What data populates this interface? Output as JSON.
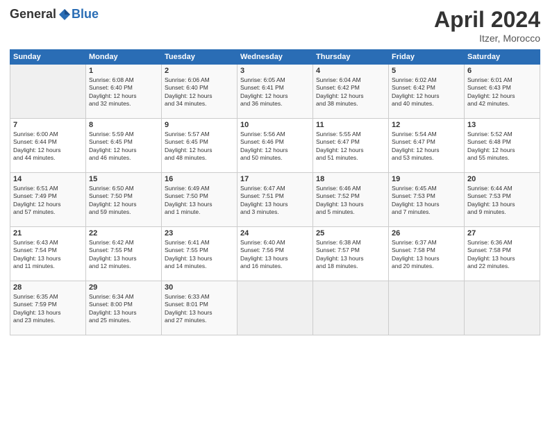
{
  "logo": {
    "general": "General",
    "blue": "Blue"
  },
  "title": "April 2024",
  "location": "Itzer, Morocco",
  "days_header": [
    "Sunday",
    "Monday",
    "Tuesday",
    "Wednesday",
    "Thursday",
    "Friday",
    "Saturday"
  ],
  "weeks": [
    [
      {
        "day": "",
        "info": ""
      },
      {
        "day": "1",
        "info": "Sunrise: 6:08 AM\nSunset: 6:40 PM\nDaylight: 12 hours\nand 32 minutes."
      },
      {
        "day": "2",
        "info": "Sunrise: 6:06 AM\nSunset: 6:40 PM\nDaylight: 12 hours\nand 34 minutes."
      },
      {
        "day": "3",
        "info": "Sunrise: 6:05 AM\nSunset: 6:41 PM\nDaylight: 12 hours\nand 36 minutes."
      },
      {
        "day": "4",
        "info": "Sunrise: 6:04 AM\nSunset: 6:42 PM\nDaylight: 12 hours\nand 38 minutes."
      },
      {
        "day": "5",
        "info": "Sunrise: 6:02 AM\nSunset: 6:42 PM\nDaylight: 12 hours\nand 40 minutes."
      },
      {
        "day": "6",
        "info": "Sunrise: 6:01 AM\nSunset: 6:43 PM\nDaylight: 12 hours\nand 42 minutes."
      }
    ],
    [
      {
        "day": "7",
        "info": "Sunrise: 6:00 AM\nSunset: 6:44 PM\nDaylight: 12 hours\nand 44 minutes."
      },
      {
        "day": "8",
        "info": "Sunrise: 5:59 AM\nSunset: 6:45 PM\nDaylight: 12 hours\nand 46 minutes."
      },
      {
        "day": "9",
        "info": "Sunrise: 5:57 AM\nSunset: 6:45 PM\nDaylight: 12 hours\nand 48 minutes."
      },
      {
        "day": "10",
        "info": "Sunrise: 5:56 AM\nSunset: 6:46 PM\nDaylight: 12 hours\nand 50 minutes."
      },
      {
        "day": "11",
        "info": "Sunrise: 5:55 AM\nSunset: 6:47 PM\nDaylight: 12 hours\nand 51 minutes."
      },
      {
        "day": "12",
        "info": "Sunrise: 5:54 AM\nSunset: 6:47 PM\nDaylight: 12 hours\nand 53 minutes."
      },
      {
        "day": "13",
        "info": "Sunrise: 5:52 AM\nSunset: 6:48 PM\nDaylight: 12 hours\nand 55 minutes."
      }
    ],
    [
      {
        "day": "14",
        "info": "Sunrise: 6:51 AM\nSunset: 7:49 PM\nDaylight: 12 hours\nand 57 minutes."
      },
      {
        "day": "15",
        "info": "Sunrise: 6:50 AM\nSunset: 7:50 PM\nDaylight: 12 hours\nand 59 minutes."
      },
      {
        "day": "16",
        "info": "Sunrise: 6:49 AM\nSunset: 7:50 PM\nDaylight: 13 hours\nand 1 minute."
      },
      {
        "day": "17",
        "info": "Sunrise: 6:47 AM\nSunset: 7:51 PM\nDaylight: 13 hours\nand 3 minutes."
      },
      {
        "day": "18",
        "info": "Sunrise: 6:46 AM\nSunset: 7:52 PM\nDaylight: 13 hours\nand 5 minutes."
      },
      {
        "day": "19",
        "info": "Sunrise: 6:45 AM\nSunset: 7:53 PM\nDaylight: 13 hours\nand 7 minutes."
      },
      {
        "day": "20",
        "info": "Sunrise: 6:44 AM\nSunset: 7:53 PM\nDaylight: 13 hours\nand 9 minutes."
      }
    ],
    [
      {
        "day": "21",
        "info": "Sunrise: 6:43 AM\nSunset: 7:54 PM\nDaylight: 13 hours\nand 11 minutes."
      },
      {
        "day": "22",
        "info": "Sunrise: 6:42 AM\nSunset: 7:55 PM\nDaylight: 13 hours\nand 12 minutes."
      },
      {
        "day": "23",
        "info": "Sunrise: 6:41 AM\nSunset: 7:55 PM\nDaylight: 13 hours\nand 14 minutes."
      },
      {
        "day": "24",
        "info": "Sunrise: 6:40 AM\nSunset: 7:56 PM\nDaylight: 13 hours\nand 16 minutes."
      },
      {
        "day": "25",
        "info": "Sunrise: 6:38 AM\nSunset: 7:57 PM\nDaylight: 13 hours\nand 18 minutes."
      },
      {
        "day": "26",
        "info": "Sunrise: 6:37 AM\nSunset: 7:58 PM\nDaylight: 13 hours\nand 20 minutes."
      },
      {
        "day": "27",
        "info": "Sunrise: 6:36 AM\nSunset: 7:58 PM\nDaylight: 13 hours\nand 22 minutes."
      }
    ],
    [
      {
        "day": "28",
        "info": "Sunrise: 6:35 AM\nSunset: 7:59 PM\nDaylight: 13 hours\nand 23 minutes."
      },
      {
        "day": "29",
        "info": "Sunrise: 6:34 AM\nSunset: 8:00 PM\nDaylight: 13 hours\nand 25 minutes."
      },
      {
        "day": "30",
        "info": "Sunrise: 6:33 AM\nSunset: 8:01 PM\nDaylight: 13 hours\nand 27 minutes."
      },
      {
        "day": "",
        "info": ""
      },
      {
        "day": "",
        "info": ""
      },
      {
        "day": "",
        "info": ""
      },
      {
        "day": "",
        "info": ""
      }
    ]
  ]
}
